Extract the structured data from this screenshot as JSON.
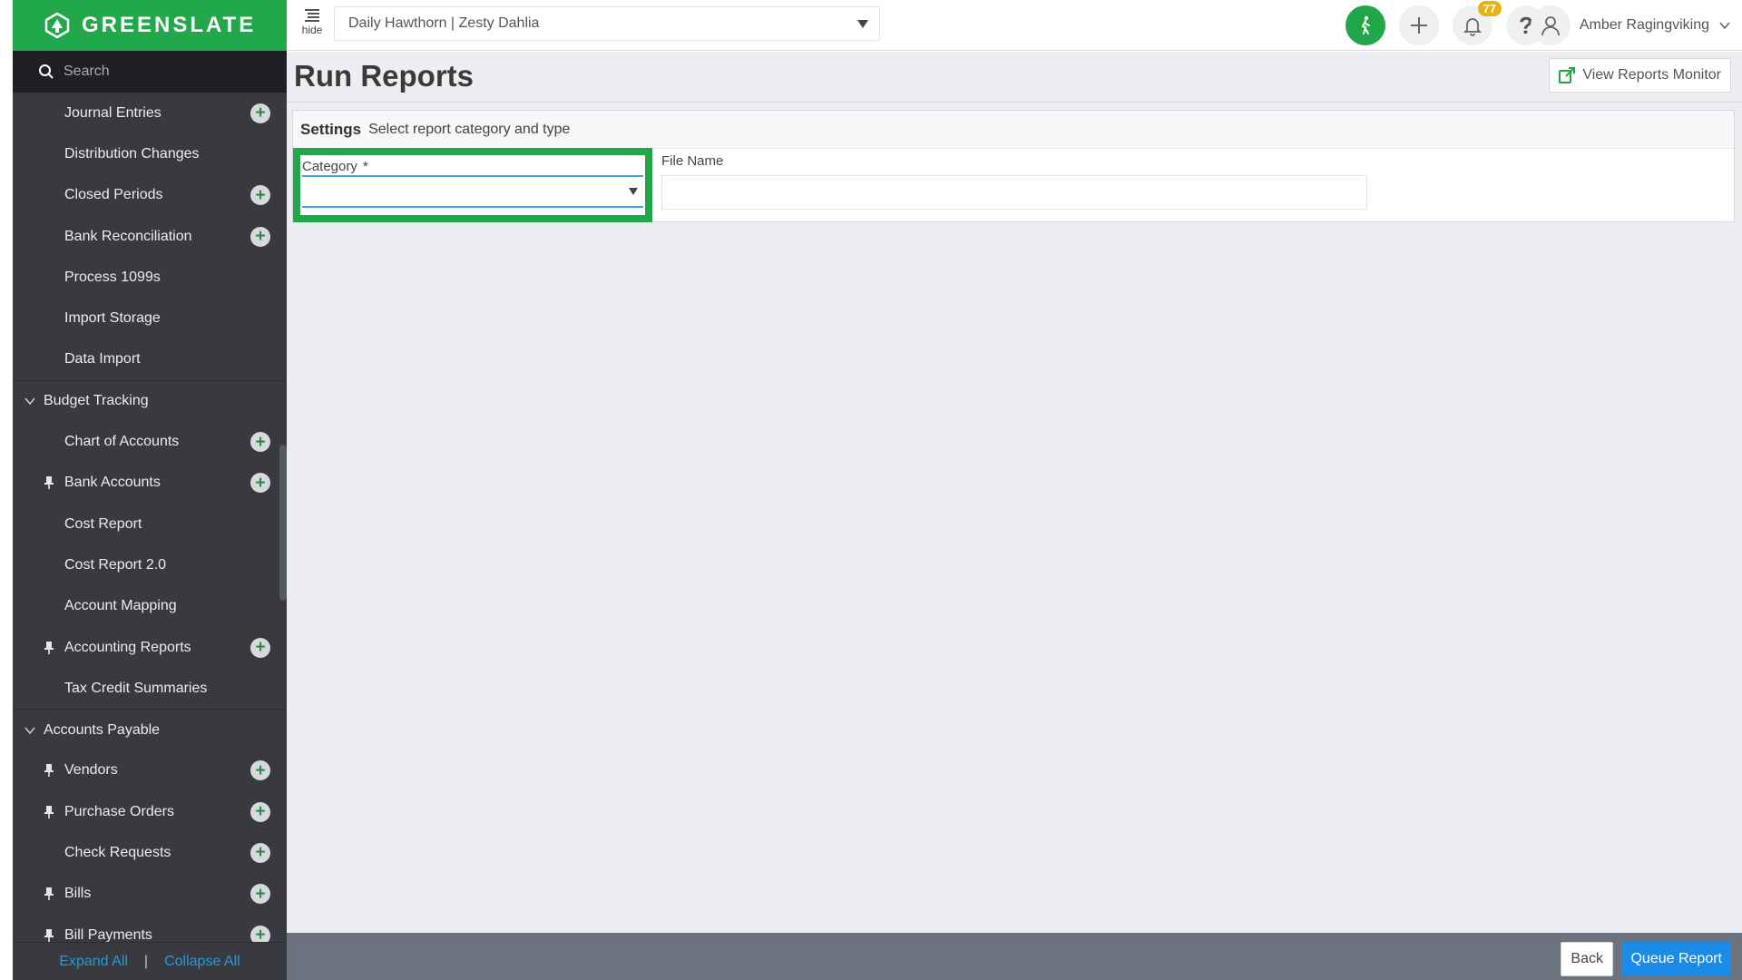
{
  "brand": {
    "name": "GREENSLATE"
  },
  "search": {
    "placeholder": "Search"
  },
  "sidebar": {
    "items": [
      {
        "label": "Journal Entries",
        "type": "item",
        "pinned": false,
        "add": true
      },
      {
        "label": "Distribution Changes",
        "type": "item",
        "pinned": false,
        "add": false
      },
      {
        "label": "Closed Periods",
        "type": "item",
        "pinned": false,
        "add": true
      },
      {
        "label": "Bank Reconciliation",
        "type": "item",
        "pinned": false,
        "add": true
      },
      {
        "label": "Process 1099s",
        "type": "item",
        "pinned": false,
        "add": false
      },
      {
        "label": "Import Storage",
        "type": "item",
        "pinned": false,
        "add": false
      },
      {
        "label": "Data Import",
        "type": "item",
        "pinned": false,
        "add": false
      },
      {
        "label": "Budget Tracking",
        "type": "section"
      },
      {
        "label": "Chart of Accounts",
        "type": "item",
        "pinned": false,
        "add": true
      },
      {
        "label": "Bank Accounts",
        "type": "item",
        "pinned": true,
        "add": true
      },
      {
        "label": "Cost Report",
        "type": "item",
        "pinned": false,
        "add": false
      },
      {
        "label": "Cost Report 2.0",
        "type": "item",
        "pinned": false,
        "add": false
      },
      {
        "label": "Account Mapping",
        "type": "item",
        "pinned": false,
        "add": false
      },
      {
        "label": "Accounting Reports",
        "type": "item",
        "pinned": true,
        "add": true
      },
      {
        "label": "Tax Credit Summaries",
        "type": "item",
        "pinned": false,
        "add": false
      },
      {
        "label": "Accounts Payable",
        "type": "section"
      },
      {
        "label": "Vendors",
        "type": "item",
        "pinned": true,
        "add": true
      },
      {
        "label": "Purchase Orders",
        "type": "item",
        "pinned": true,
        "add": true
      },
      {
        "label": "Check Requests",
        "type": "item",
        "pinned": false,
        "add": true
      },
      {
        "label": "Bills",
        "type": "item",
        "pinned": true,
        "add": true
      },
      {
        "label": "Bill Payments",
        "type": "item",
        "pinned": true,
        "add": true
      }
    ],
    "expand_all": "Expand All",
    "separator": "|",
    "collapse_all": "Collapse All"
  },
  "topbar": {
    "hide_label": "hide",
    "entity": "Daily Hawthorn | Zesty Dahlia",
    "notifications_count": "77",
    "help_glyph": "?",
    "user_name": "Amber Ragingviking"
  },
  "main": {
    "title": "Run Reports",
    "view_monitor": "View Reports Monitor",
    "settings_title": "Settings",
    "settings_subtitle": "Select report category and type",
    "category_label": "Category",
    "category_required": "*",
    "category_value": "",
    "file_name_label": "File Name",
    "file_name_value": ""
  },
  "footer": {
    "back": "Back",
    "queue": "Queue Report"
  },
  "colors": {
    "brand_green": "#20a84a",
    "accent_blue": "#1b8be8",
    "link_blue": "#1e9be3",
    "badge_yellow": "#e8b116"
  }
}
